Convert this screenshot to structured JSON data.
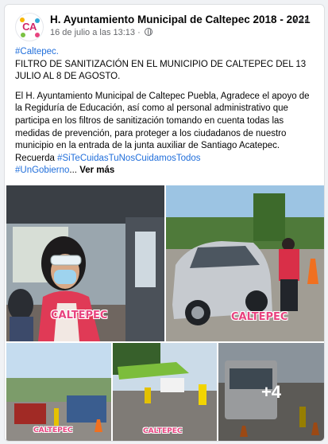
{
  "post": {
    "page_name": "H. Ayuntamiento Municipal de Caltepec 2018 - 2021",
    "avatar_text": "CA",
    "timestamp": "16 de julio a las 13:13",
    "separator": "·",
    "more_icon": "more-horizontal-icon",
    "privacy_icon": "globe-icon",
    "hashtag_top": "#Caltepec.",
    "headline": "FILTRO DE SANITIZACIÓN EN EL MUNICIPIO DE CALTEPEC DEL 13 JULIO AL 8 DE AGOSTO.",
    "body": "El H. Ayuntamiento Municipal de Caltepec Puebla, Agradece el apoyo de la Regiduría de Educación, así como al personal administrativo que participa en los filtros de sanitización tomando en cuenta todas las medidas de prevención, para proteger a los ciudadanos de nuestro municipio en la entrada de la junta auxiliar de Santiago Acatepec. Recuerda ",
    "hashtag_inline": "#SiTeCuidasTuNosCuidamosTodos",
    "hashtag_last": "#UnGobierno",
    "ellipsis": "...",
    "see_more": "Ver más"
  },
  "photos": {
    "overlay_text": "CALTEPEC",
    "overlay_subtitle": "UN GOBIERNO INCLUYENTE\nH. AYUNTAMIENTO MUNICIPAL\n2018 - 2021",
    "more_count": "+4"
  },
  "colors": {
    "hashtag": "#216fdb",
    "secondary_text": "#65676b",
    "logo_pink": "#e8437f"
  }
}
